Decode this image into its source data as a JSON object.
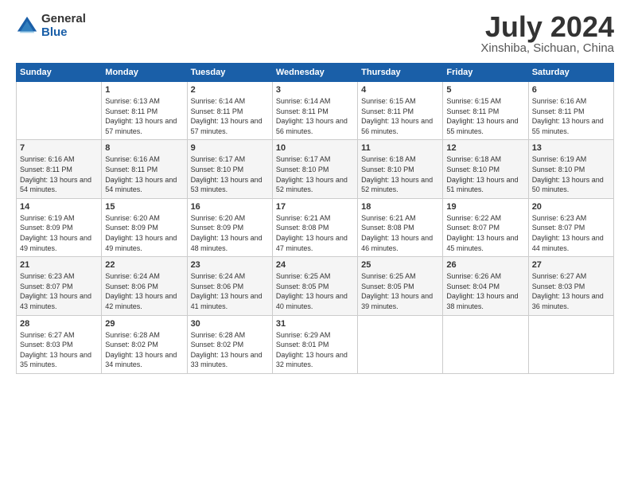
{
  "header": {
    "logo_general": "General",
    "logo_blue": "Blue",
    "month_year": "July 2024",
    "location": "Xinshiba, Sichuan, China"
  },
  "calendar": {
    "days_of_week": [
      "Sunday",
      "Monday",
      "Tuesday",
      "Wednesday",
      "Thursday",
      "Friday",
      "Saturday"
    ],
    "weeks": [
      [
        {
          "day": "",
          "sunrise": "",
          "sunset": "",
          "daylight": ""
        },
        {
          "day": "1",
          "sunrise": "Sunrise: 6:13 AM",
          "sunset": "Sunset: 8:11 PM",
          "daylight": "Daylight: 13 hours and 57 minutes."
        },
        {
          "day": "2",
          "sunrise": "Sunrise: 6:14 AM",
          "sunset": "Sunset: 8:11 PM",
          "daylight": "Daylight: 13 hours and 57 minutes."
        },
        {
          "day": "3",
          "sunrise": "Sunrise: 6:14 AM",
          "sunset": "Sunset: 8:11 PM",
          "daylight": "Daylight: 13 hours and 56 minutes."
        },
        {
          "day": "4",
          "sunrise": "Sunrise: 6:15 AM",
          "sunset": "Sunset: 8:11 PM",
          "daylight": "Daylight: 13 hours and 56 minutes."
        },
        {
          "day": "5",
          "sunrise": "Sunrise: 6:15 AM",
          "sunset": "Sunset: 8:11 PM",
          "daylight": "Daylight: 13 hours and 55 minutes."
        },
        {
          "day": "6",
          "sunrise": "Sunrise: 6:16 AM",
          "sunset": "Sunset: 8:11 PM",
          "daylight": "Daylight: 13 hours and 55 minutes."
        }
      ],
      [
        {
          "day": "7",
          "sunrise": "Sunrise: 6:16 AM",
          "sunset": "Sunset: 8:11 PM",
          "daylight": "Daylight: 13 hours and 54 minutes."
        },
        {
          "day": "8",
          "sunrise": "Sunrise: 6:16 AM",
          "sunset": "Sunset: 8:11 PM",
          "daylight": "Daylight: 13 hours and 54 minutes."
        },
        {
          "day": "9",
          "sunrise": "Sunrise: 6:17 AM",
          "sunset": "Sunset: 8:10 PM",
          "daylight": "Daylight: 13 hours and 53 minutes."
        },
        {
          "day": "10",
          "sunrise": "Sunrise: 6:17 AM",
          "sunset": "Sunset: 8:10 PM",
          "daylight": "Daylight: 13 hours and 52 minutes."
        },
        {
          "day": "11",
          "sunrise": "Sunrise: 6:18 AM",
          "sunset": "Sunset: 8:10 PM",
          "daylight": "Daylight: 13 hours and 52 minutes."
        },
        {
          "day": "12",
          "sunrise": "Sunrise: 6:18 AM",
          "sunset": "Sunset: 8:10 PM",
          "daylight": "Daylight: 13 hours and 51 minutes."
        },
        {
          "day": "13",
          "sunrise": "Sunrise: 6:19 AM",
          "sunset": "Sunset: 8:10 PM",
          "daylight": "Daylight: 13 hours and 50 minutes."
        }
      ],
      [
        {
          "day": "14",
          "sunrise": "Sunrise: 6:19 AM",
          "sunset": "Sunset: 8:09 PM",
          "daylight": "Daylight: 13 hours and 49 minutes."
        },
        {
          "day": "15",
          "sunrise": "Sunrise: 6:20 AM",
          "sunset": "Sunset: 8:09 PM",
          "daylight": "Daylight: 13 hours and 49 minutes."
        },
        {
          "day": "16",
          "sunrise": "Sunrise: 6:20 AM",
          "sunset": "Sunset: 8:09 PM",
          "daylight": "Daylight: 13 hours and 48 minutes."
        },
        {
          "day": "17",
          "sunrise": "Sunrise: 6:21 AM",
          "sunset": "Sunset: 8:08 PM",
          "daylight": "Daylight: 13 hours and 47 minutes."
        },
        {
          "day": "18",
          "sunrise": "Sunrise: 6:21 AM",
          "sunset": "Sunset: 8:08 PM",
          "daylight": "Daylight: 13 hours and 46 minutes."
        },
        {
          "day": "19",
          "sunrise": "Sunrise: 6:22 AM",
          "sunset": "Sunset: 8:07 PM",
          "daylight": "Daylight: 13 hours and 45 minutes."
        },
        {
          "day": "20",
          "sunrise": "Sunrise: 6:23 AM",
          "sunset": "Sunset: 8:07 PM",
          "daylight": "Daylight: 13 hours and 44 minutes."
        }
      ],
      [
        {
          "day": "21",
          "sunrise": "Sunrise: 6:23 AM",
          "sunset": "Sunset: 8:07 PM",
          "daylight": "Daylight: 13 hours and 43 minutes."
        },
        {
          "day": "22",
          "sunrise": "Sunrise: 6:24 AM",
          "sunset": "Sunset: 8:06 PM",
          "daylight": "Daylight: 13 hours and 42 minutes."
        },
        {
          "day": "23",
          "sunrise": "Sunrise: 6:24 AM",
          "sunset": "Sunset: 8:06 PM",
          "daylight": "Daylight: 13 hours and 41 minutes."
        },
        {
          "day": "24",
          "sunrise": "Sunrise: 6:25 AM",
          "sunset": "Sunset: 8:05 PM",
          "daylight": "Daylight: 13 hours and 40 minutes."
        },
        {
          "day": "25",
          "sunrise": "Sunrise: 6:25 AM",
          "sunset": "Sunset: 8:05 PM",
          "daylight": "Daylight: 13 hours and 39 minutes."
        },
        {
          "day": "26",
          "sunrise": "Sunrise: 6:26 AM",
          "sunset": "Sunset: 8:04 PM",
          "daylight": "Daylight: 13 hours and 38 minutes."
        },
        {
          "day": "27",
          "sunrise": "Sunrise: 6:27 AM",
          "sunset": "Sunset: 8:03 PM",
          "daylight": "Daylight: 13 hours and 36 minutes."
        }
      ],
      [
        {
          "day": "28",
          "sunrise": "Sunrise: 6:27 AM",
          "sunset": "Sunset: 8:03 PM",
          "daylight": "Daylight: 13 hours and 35 minutes."
        },
        {
          "day": "29",
          "sunrise": "Sunrise: 6:28 AM",
          "sunset": "Sunset: 8:02 PM",
          "daylight": "Daylight: 13 hours and 34 minutes."
        },
        {
          "day": "30",
          "sunrise": "Sunrise: 6:28 AM",
          "sunset": "Sunset: 8:02 PM",
          "daylight": "Daylight: 13 hours and 33 minutes."
        },
        {
          "day": "31",
          "sunrise": "Sunrise: 6:29 AM",
          "sunset": "Sunset: 8:01 PM",
          "daylight": "Daylight: 13 hours and 32 minutes."
        },
        {
          "day": "",
          "sunrise": "",
          "sunset": "",
          "daylight": ""
        },
        {
          "day": "",
          "sunrise": "",
          "sunset": "",
          "daylight": ""
        },
        {
          "day": "",
          "sunrise": "",
          "sunset": "",
          "daylight": ""
        }
      ]
    ]
  }
}
